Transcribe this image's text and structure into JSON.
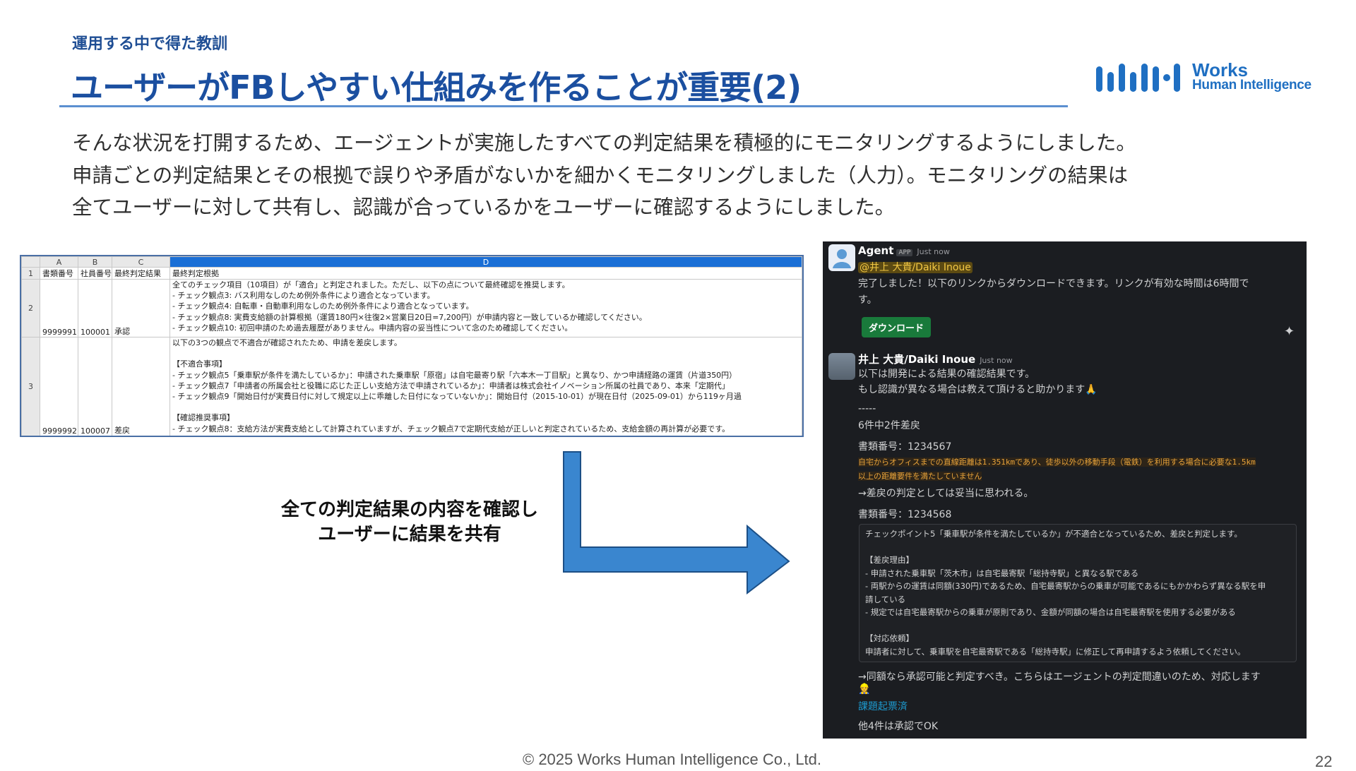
{
  "slide": {
    "section_label": "運用する中で得た教訓",
    "title": "ユーザーがFBしやすい仕組みを作ることが重要(2)",
    "body_lines": [
      "そんな状況を打開するため、エージェントが実施したすべての判定結果を積極的にモニタリングするようにしました。",
      "申請ごとの判定結果とその根拠で誤りや矛盾がないかを細かくモニタリングしました（人力）。モニタリングの結果は",
      "全てユーザーに対して共有し、認識が合っているかをユーザーに確認するようにしました。"
    ],
    "caption_lines": [
      "全ての判定結果の内容を確認し",
      "ユーザーに結果を共有"
    ],
    "footer": "© 2025 Works Human Intelligence Co., Ltd.",
    "page_number": "22",
    "logo": {
      "line1": "Works",
      "line2": "Human Intelligence"
    },
    "accent_color": "#1b4fa0"
  },
  "sheet": {
    "col_letters": [
      "A",
      "B",
      "C",
      "D"
    ],
    "headers": [
      "書類番号",
      "社員番号",
      "最終判定結果",
      "最終判定根拠"
    ],
    "rows": [
      {
        "num": "2",
        "doc": "9999991",
        "emp": "100001",
        "result": "承認",
        "reasons": [
          "全てのチェック項目（10項目）が「適合」と判定されました。ただし、以下の点について最終確認を推奨します。",
          "- チェック観点3: バス利用なしのため例外条件により適合となっています。",
          "- チェック観点4: 自転車・自動車利用なしのため例外条件により適合となっています。",
          "- チェック観点8: 実費支給額の計算根拠（運賃180円×往復2×営業日20日=7,200円）が申請内容と一致しているか確認してください。",
          "- チェック観点10: 初回申請のため過去履歴がありません。申請内容の妥当性について念のため確認してください。"
        ]
      },
      {
        "num": "3",
        "doc": "9999992",
        "emp": "100007",
        "result": "差戻",
        "reasons": [
          "以下の3つの観点で不適合が確認されたため、申請を差戻します。",
          "",
          "【不適合事項】",
          "- チェック観点5「乗車駅が条件を満たしているか」：申請された乗車駅「原宿」は自宅最寄り駅「六本木一丁目駅」と異なり、かつ申請経路の運賃（片道350円）",
          "- チェック観点7「申請者の所属会社と役職に応じた正しい支給方法で申請されているか」：申請者は株式会社イノベーション所属の社員であり、本来「定期代」",
          "- チェック観点9「開始日付が実費日付に対して規定以上に乖離した日付になっていないか」：開始日付（2015-10-01）が現在日付（2025-09-01）から119ヶ月過",
          "",
          "【確認推奨事項】",
          "- チェック観点8：支給方法が実費支給として計算されていますが、チェック観点7で定期代支給が正しいと判定されているため、支給金額の再計算が必要です。"
        ]
      }
    ]
  },
  "chat": {
    "msg1": {
      "author": "Agent",
      "badge": "APP",
      "time": "Just now",
      "mention": "@井上 大貴/Daiki Inoue",
      "text1": "完了しました！以下のリンクからダウンロードできます。リンクが有効な時間は6時間で",
      "text2": "す。",
      "button": "ダウンロード",
      "sparkle": "✦"
    },
    "msg2": {
      "author": "井上 大貴/Daiki Inoue",
      "time": "Just now",
      "l1": "以下は開発による結果の確認結果です。",
      "l2": "もし認識が異なる場合は教えて頂けると助かります🙏",
      "sep": "-----",
      "summary": "6件中2件差戻",
      "doc1": "書類番号：1234567",
      "hl1": "自宅からオフィスまでの直線距離は1.351kmであり、徒歩以外の移動手段（電鉄）を利用する場合に必要な1.5km",
      "hl2": "以上の距離要件を満たしていません",
      "judge1": "→差戻の判定としては妥当に思われる。",
      "doc2": "書類番号：1234568",
      "quote": [
        "チェックポイント5「乗車駅が条件を満たしているか」が不適合となっているため、差戻と判定します。",
        "",
        "【差戻理由】",
        "- 申請された乗車駅「茨木市」は自宅最寄駅「総持寺駅」と異なる駅である",
        "- 両駅からの運賃は同額(330円)であるため、自宅最寄駅からの乗車が可能であるにもかかわらず異なる駅を申",
        "請している",
        "- 規定では自宅最寄駅からの乗車が原則であり、金額が同額の場合は自宅最寄駅を使用する必要がある",
        "",
        "【対応依頼】",
        "申請者に対して、乗車駅を自宅最寄駅である「総持寺駅」に修正して再申請するよう依頼してください。"
      ],
      "judge2": "→同額なら承認可能と判定すべき。こちらはエージェントの判定間違いのため、対応します",
      "emoji": "👷",
      "link": "課題起票済",
      "final": "他4件は承認でOK"
    }
  }
}
